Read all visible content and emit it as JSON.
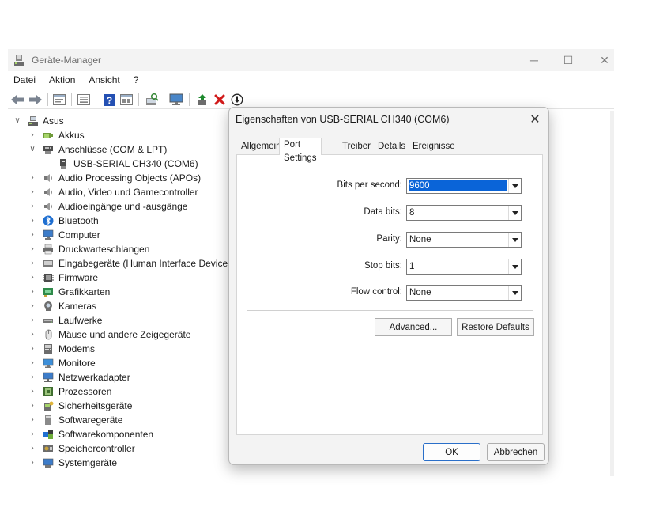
{
  "window": {
    "title": "Geräte-Manager",
    "controls": {
      "minimize": "─",
      "maximize": "☐",
      "close": "✕"
    }
  },
  "menu": [
    {
      "label": "Datei"
    },
    {
      "label": "Aktion"
    },
    {
      "label": "Ansicht"
    },
    {
      "label": "?"
    }
  ],
  "toolbar": {
    "icons": [
      "back-arrow-icon",
      "forward-arrow-icon",
      "properties-icon",
      "list-view-icon",
      "help-icon",
      "update-driver-icon",
      "scan-hardware-icon",
      "monitor-icon",
      "enable-device-icon",
      "uninstall-icon",
      "download-driver-icon"
    ]
  },
  "tree": {
    "root": "Asus",
    "items": [
      {
        "label": "Akkus",
        "icon": "battery-icon",
        "expanded": false
      },
      {
        "label": "Anschlüsse (COM & LPT)",
        "icon": "port-icon",
        "expanded": true
      },
      {
        "label": "USB-SERIAL CH340 (COM6)",
        "icon": "usb-serial-icon",
        "child": true
      },
      {
        "label": "Audio Processing Objects (APOs)",
        "icon": "speaker-icon",
        "expanded": false
      },
      {
        "label": "Audio, Video und Gamecontroller",
        "icon": "speaker-icon",
        "expanded": false
      },
      {
        "label": "Audioeingänge und -ausgänge",
        "icon": "speaker-icon",
        "expanded": false
      },
      {
        "label": "Bluetooth",
        "icon": "bluetooth-icon",
        "expanded": false
      },
      {
        "label": "Computer",
        "icon": "computer-icon",
        "expanded": false
      },
      {
        "label": "Druckwarteschlangen",
        "icon": "printer-icon",
        "expanded": false
      },
      {
        "label": "Eingabegeräte (Human Interface Devices)",
        "icon": "hid-icon",
        "expanded": false
      },
      {
        "label": "Firmware",
        "icon": "firmware-icon",
        "expanded": false
      },
      {
        "label": "Grafikkarten",
        "icon": "display-adapter-icon",
        "expanded": false
      },
      {
        "label": "Kameras",
        "icon": "camera-icon",
        "expanded": false
      },
      {
        "label": "Laufwerke",
        "icon": "drive-icon",
        "expanded": false
      },
      {
        "label": "Mäuse und andere Zeigegeräte",
        "icon": "mouse-icon",
        "expanded": false
      },
      {
        "label": "Modems",
        "icon": "modem-icon",
        "expanded": false
      },
      {
        "label": "Monitore",
        "icon": "monitor-icon",
        "expanded": false
      },
      {
        "label": "Netzwerkadapter",
        "icon": "network-adapter-icon",
        "expanded": false
      },
      {
        "label": "Prozessoren",
        "icon": "processor-icon",
        "expanded": false
      },
      {
        "label": "Sicherheitsgeräte",
        "icon": "security-device-icon",
        "expanded": false
      },
      {
        "label": "Softwaregeräte",
        "icon": "software-device-icon",
        "expanded": false
      },
      {
        "label": "Softwarekomponenten",
        "icon": "software-component-icon",
        "expanded": false
      },
      {
        "label": "Speichercontroller",
        "icon": "storage-controller-icon",
        "expanded": false
      },
      {
        "label": "Systemgeräte",
        "icon": "system-device-icon",
        "expanded": false
      }
    ]
  },
  "dialog": {
    "title": "Eigenschaften von USB-SERIAL CH340 (COM6)",
    "close": "✕",
    "tabs": [
      {
        "label": "Allgemein",
        "active": false
      },
      {
        "label": "Port Settings",
        "active": true
      },
      {
        "label": "Treiber",
        "active": false
      },
      {
        "label": "Details",
        "active": false
      },
      {
        "label": "Ereignisse",
        "active": false
      }
    ],
    "fields": [
      {
        "label": "Bits per second:",
        "value": "9600",
        "selected": true
      },
      {
        "label": "Data bits:",
        "value": "8",
        "selected": false
      },
      {
        "label": "Parity:",
        "value": "None",
        "selected": false
      },
      {
        "label": "Stop bits:",
        "value": "1",
        "selected": false
      },
      {
        "label": "Flow control:",
        "value": "None",
        "selected": false
      }
    ],
    "advanced_label": "Advanced...",
    "restore_label": "Restore Defaults",
    "ok_label": "OK",
    "cancel_label": "Abbrechen"
  },
  "colors": {
    "selection": "#0a64d8",
    "accent": "#2a6fc9",
    "uninstall_red": "#d11a1a",
    "enable_green": "#1e8a2e"
  }
}
